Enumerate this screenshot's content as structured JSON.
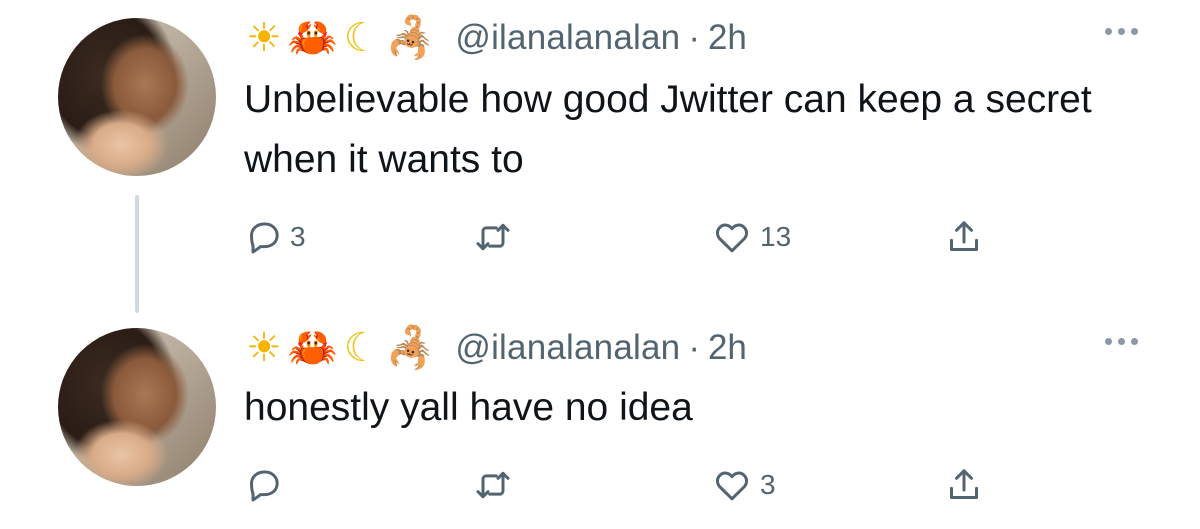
{
  "tweets": [
    {
      "emojis": [
        "☀",
        "🦀",
        "☾",
        "🦂"
      ],
      "handle": "@ilanalanalan",
      "separator": "·",
      "time": "2h",
      "text": "Unbelievable how good Jwitter can keep a secret when it wants to",
      "replies": "3",
      "retweets": "",
      "likes": "13"
    },
    {
      "emojis": [
        "☀",
        "🦀",
        "☾",
        "🦂"
      ],
      "handle": "@ilanalanalan",
      "separator": "·",
      "time": "2h",
      "text": "honestly yall have no idea",
      "replies": "",
      "retweets": "",
      "likes": "3"
    }
  ],
  "colors": {
    "text": "#0f1419",
    "secondary": "#536471",
    "thread_line": "#cfd9de"
  }
}
